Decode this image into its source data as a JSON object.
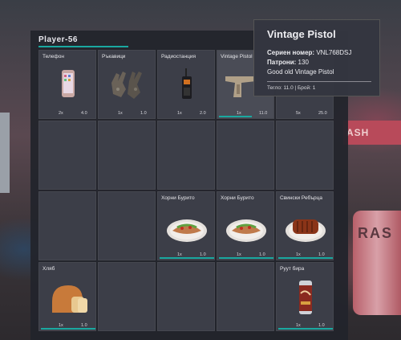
{
  "inventory": {
    "title": "Player-56",
    "slots": [
      {
        "label": "Телефон",
        "icon": "phone-icon",
        "count": "2x",
        "weight": "4.0",
        "has_bar": false
      },
      {
        "label": "Ръкавици",
        "icon": "gloves-icon",
        "count": "1x",
        "weight": "1.0",
        "has_bar": false
      },
      {
        "label": "Радиостанция",
        "icon": "radio-icon",
        "count": "1x",
        "weight": "2.0",
        "has_bar": false
      },
      {
        "label": "Vintage Pistol",
        "icon": "pistol-icon",
        "count": "1x",
        "weight": "11.0",
        "has_bar": true,
        "bar_fill": 0.6
      },
      {
        "label": "",
        "icon": "",
        "count": "5x",
        "weight": "25.0",
        "has_bar": false
      },
      {
        "label": "",
        "icon": "",
        "count": "",
        "weight": ""
      },
      {
        "label": "",
        "icon": "",
        "count": "",
        "weight": ""
      },
      {
        "label": "",
        "icon": "",
        "count": "",
        "weight": ""
      },
      {
        "label": "",
        "icon": "",
        "count": "",
        "weight": ""
      },
      {
        "label": "",
        "icon": "",
        "count": "",
        "weight": ""
      },
      {
        "label": "",
        "icon": "",
        "count": "",
        "weight": ""
      },
      {
        "label": "",
        "icon": "",
        "count": "",
        "weight": ""
      },
      {
        "label": "Хорни Бурито",
        "icon": "burrito-icon",
        "count": "1x",
        "weight": "1.0",
        "has_bar": true,
        "bar_fill": 1.0
      },
      {
        "label": "Хорни Бурито",
        "icon": "burrito-icon",
        "count": "1x",
        "weight": "1.0",
        "has_bar": true,
        "bar_fill": 1.0
      },
      {
        "label": "Свински Ребърца",
        "icon": "ribs-icon",
        "count": "1x",
        "weight": "1.0",
        "has_bar": true,
        "bar_fill": 1.0
      },
      {
        "label": "Хляб",
        "icon": "bread-icon",
        "count": "1x",
        "weight": "1.0",
        "has_bar": true,
        "bar_fill": 1.0
      },
      {
        "label": "",
        "icon": "",
        "count": "",
        "weight": ""
      },
      {
        "label": "",
        "icon": "",
        "count": "",
        "weight": ""
      },
      {
        "label": "",
        "icon": "",
        "count": "",
        "weight": ""
      },
      {
        "label": "Руут бира",
        "icon": "root-beer-can-icon",
        "count": "1x",
        "weight": "1.0",
        "has_bar": true,
        "bar_fill": 1.0
      }
    ]
  },
  "tooltip": {
    "title": "Vintage Pistol",
    "serial_label": "Сериен номер:",
    "serial_value": "VNL768DSJ",
    "ammo_label": "Патрони:",
    "ammo_value": "130",
    "description": "Good old Vintage Pistol",
    "footer": "Тегло: 11.0 | Брой: 1"
  },
  "background": {
    "sign_text": "ASH",
    "barrel_text": "RAS"
  },
  "colors": {
    "accent": "#1aa8a0",
    "panel": "#22242c",
    "slot": "#3c3e48"
  }
}
